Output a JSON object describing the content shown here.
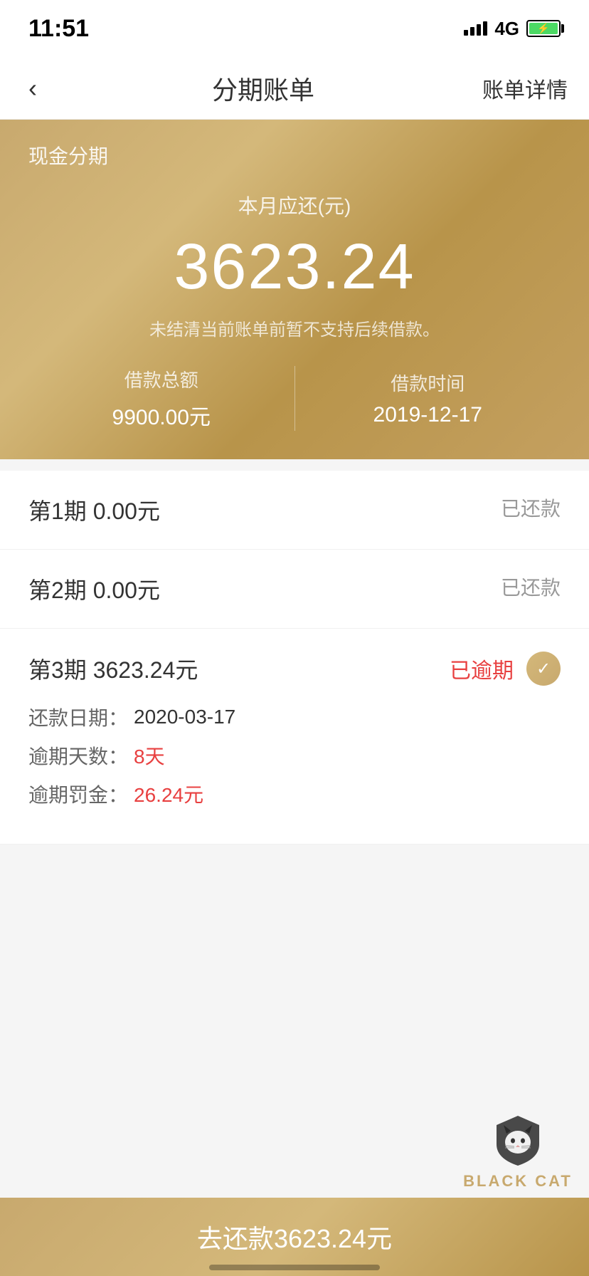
{
  "statusBar": {
    "time": "11:51",
    "signal": "4G"
  },
  "navBar": {
    "backLabel": "‹",
    "title": "分期账单",
    "detailLabel": "账单详情"
  },
  "header": {
    "sectionLabel": "现金分期",
    "monthLabel": "本月应还(元)",
    "amount": "3623.24",
    "notice": "未结清当前账单前暂不支持后续借款。",
    "loanAmountLabel": "借款总额",
    "loanAmountValue": "9900.00元",
    "loanDateLabel": "借款时间",
    "loanDateValue": "2019-12-17"
  },
  "installments": [
    {
      "label": "第1期  0.00元",
      "status": "已还款",
      "isOverdue": false,
      "expanded": false
    },
    {
      "label": "第2期  0.00元",
      "status": "已还款",
      "isOverdue": false,
      "expanded": false
    },
    {
      "label": "第3期  3623.24元",
      "status": "已逾期",
      "isOverdue": true,
      "expanded": true,
      "repayDateLabel": "还款日期：",
      "repayDateValue": "2020-03-17",
      "overdueDaysLabel": "逾期天数：",
      "overdueDaysValue": "8天",
      "overdueFineLabel": "逾期罚金：",
      "overdueFineValue": "26.24元"
    }
  ],
  "bottomBar": {
    "payLabel": "去还款  ",
    "payAmount": "3623.24元"
  },
  "blackCat": {
    "text": "BLACK CAT"
  }
}
